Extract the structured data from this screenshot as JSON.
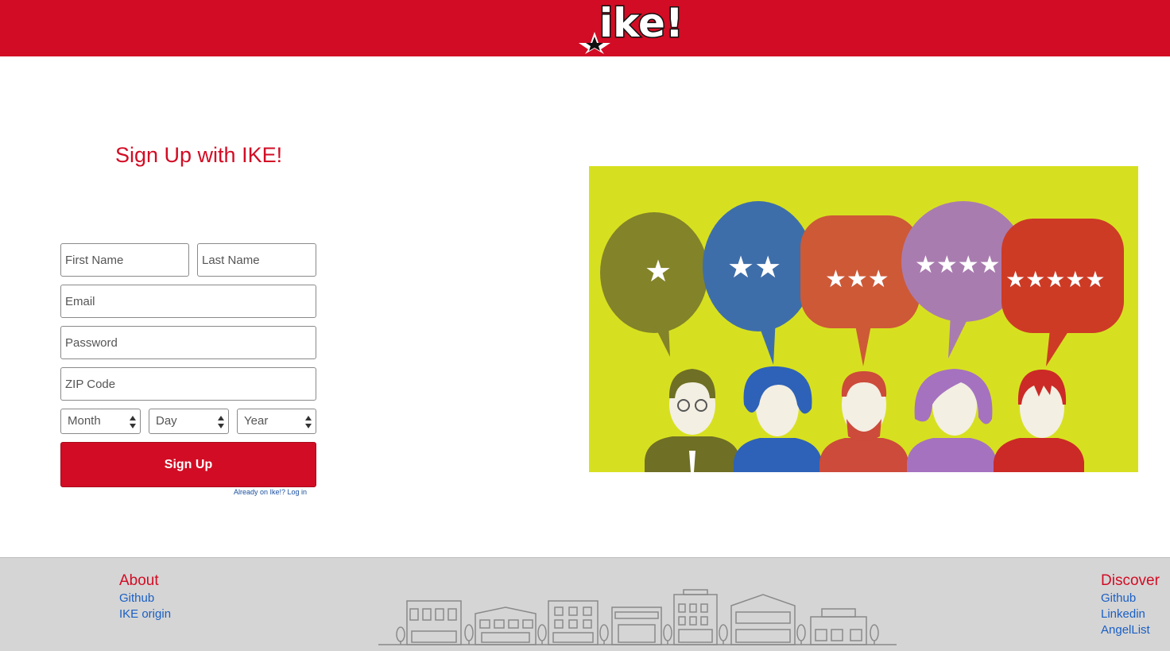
{
  "header": {
    "logo_text": "ike!",
    "brand_color": "#d20c24"
  },
  "form": {
    "title": "Sign Up with IKE!",
    "first_name_placeholder": "First Name",
    "last_name_placeholder": "Last Name",
    "email_placeholder": "Email",
    "password_placeholder": "Password",
    "zip_placeholder": "ZIP Code",
    "month_label": "Month",
    "day_label": "Day",
    "year_label": "Year",
    "submit_label": "Sign Up",
    "login_link": "Already on Ike!? Log in"
  },
  "hero": {
    "background_color": "#d7e020",
    "bubbles": [
      {
        "stars": "★",
        "color": "#7a7a2a"
      },
      {
        "stars": "★★",
        "color": "#2e62b8"
      },
      {
        "stars": "★★★",
        "color": "#cc4b3a"
      },
      {
        "stars": "★★★★",
        "color": "#a572bf"
      },
      {
        "stars": "★★★★★",
        "color": "#cc2a26"
      }
    ]
  },
  "footer": {
    "about_heading": "About",
    "about_links": [
      "Github",
      "IKE origin"
    ],
    "discover_heading": "Discover",
    "discover_links": [
      "Github",
      "Linkedin",
      "AngelList"
    ]
  }
}
